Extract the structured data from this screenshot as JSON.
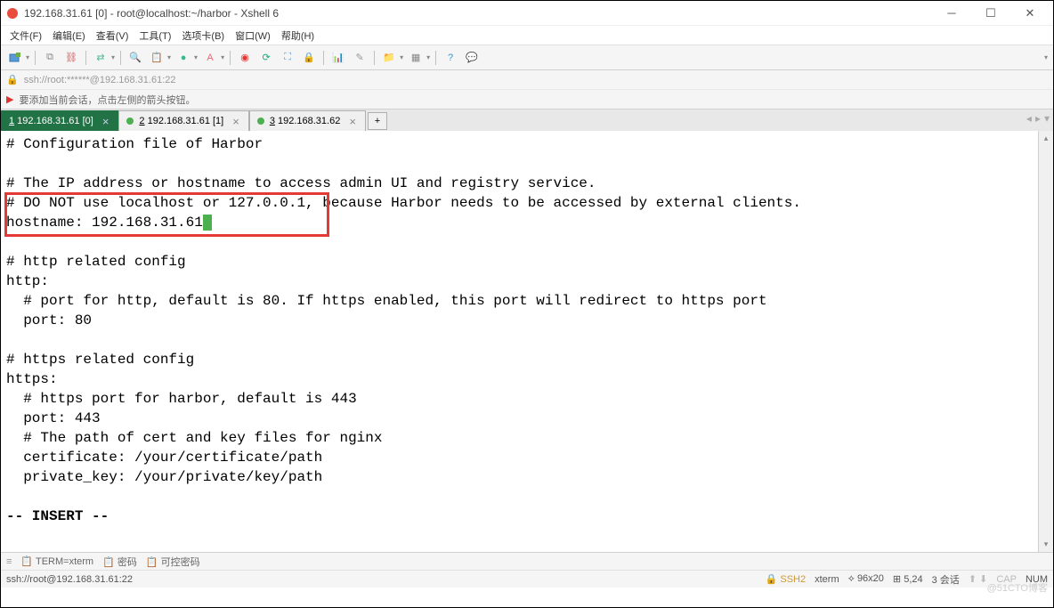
{
  "window": {
    "title": "192.168.31.61 [0] - root@localhost:~/harbor - Xshell 6"
  },
  "menu": {
    "file": "文件(F)",
    "edit": "编辑(E)",
    "view": "查看(V)",
    "tools": "工具(T)",
    "options": "选项卡(B)",
    "window": "窗口(W)",
    "help": "帮助(H)"
  },
  "addr": {
    "text": "ssh://root:******@192.168.31.61:22"
  },
  "hint": {
    "text": "要添加当前会话，点击左侧的箭头按钮。"
  },
  "tabs": {
    "t1": {
      "label": "1 192.168.31.61 [0]",
      "num": "1",
      "rest": " 192.168.31.61 [0]"
    },
    "t2": {
      "label": "2 192.168.31.61 [1]",
      "num": "2",
      "rest": " 192.168.31.61 [1]"
    },
    "t3": {
      "label": "3 192.168.31.62",
      "num": "3",
      "rest": " 192.168.31.62"
    }
  },
  "terminal": {
    "l01": "# Configuration file of Harbor",
    "l02": "",
    "l03": "# The IP address or hostname to access admin UI and registry service.",
    "l04": "# DO NOT use localhost or 127.0.0.1, because Harbor needs to be accessed by external clients.",
    "l05_pre": "hostname: 192.168.31.61",
    "l06": "",
    "l07": "# http related config",
    "l08": "http:",
    "l09": "  # port for http, default is 80. If https enabled, this port will redirect to https port",
    "l10": "  port: 80",
    "l11": "",
    "l12": "# https related config",
    "l13": "https:",
    "l14": "  # https port for harbor, default is 443",
    "l15": "  port: 443",
    "l16": "  # The path of cert and key files for nginx",
    "l17": "  certificate: /your/certificate/path",
    "l18": "  private_key: /your/private/key/path",
    "l19": "",
    "l20": "-- INSERT --"
  },
  "infobar": {
    "term": "TERM=xterm",
    "pw": "密码",
    "cpw": "可控密码"
  },
  "status": {
    "left": "ssh://root@192.168.31.61:22",
    "ssh": "SSH2",
    "xterm": "xterm",
    "size": "96x20",
    "pos": "5,24",
    "sess": "3 会话",
    "cap": "CAP",
    "num": "NUM"
  },
  "watermark": "@51CTO博客"
}
